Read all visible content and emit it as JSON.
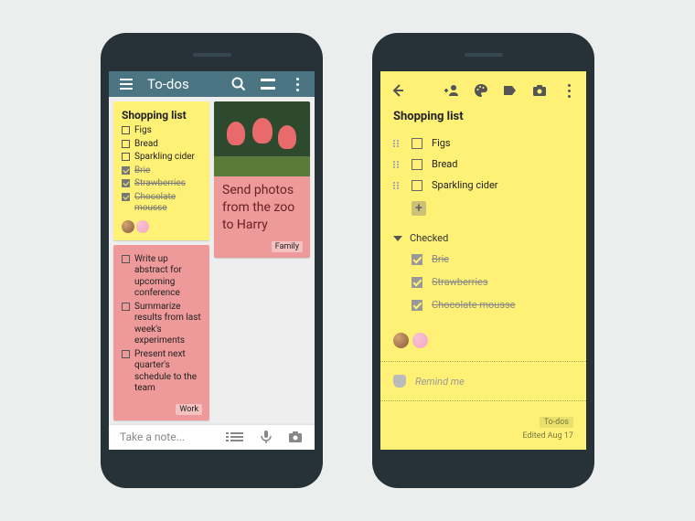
{
  "left": {
    "header_title": "To-dos",
    "notes": {
      "shopping": {
        "title": "Shopping list",
        "unchecked": [
          "Figs",
          "Bread",
          "Sparkling cider"
        ],
        "checked": [
          "Brie",
          "Strawberries",
          "Chocolate mousse"
        ]
      },
      "work": {
        "items": [
          "Write up abstract for upcoming conference",
          "Summarize results from last week's experiments",
          "Present next quarter's schedule to the team"
        ],
        "label": "Work"
      },
      "zoo": {
        "text": "Send photos from the zoo to Harry",
        "label": "Family"
      }
    },
    "compose_placeholder": "Take a note..."
  },
  "right": {
    "title": "Shopping list",
    "unchecked": [
      "Figs",
      "Bread",
      "Sparkling cider"
    ],
    "checked_header": "Checked",
    "checked": [
      "Brie",
      "Strawberries",
      "Chocolate mousse"
    ],
    "remind_label": "Remind me",
    "tag": "To-dos",
    "edited": "Edited Aug 17"
  }
}
